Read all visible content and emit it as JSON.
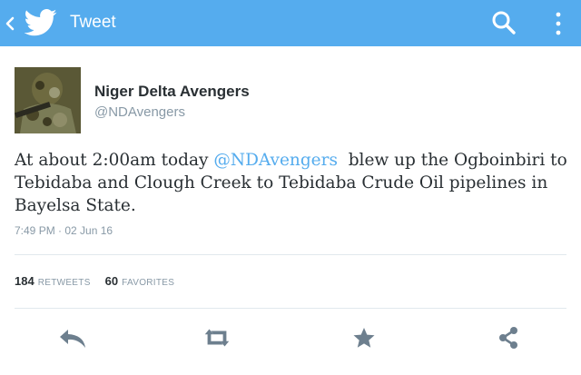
{
  "appbar": {
    "title": "Tweet",
    "color": "#55acee",
    "icons": [
      "back-chevron-icon",
      "twitter-bird-icon",
      "search-icon",
      "overflow-menu-icon"
    ]
  },
  "author": {
    "name": "Niger Delta Avengers",
    "handle": "@NDAvengers"
  },
  "tweet": {
    "text_before": "At about 2:00am today ",
    "mention": "@NDAvengers",
    "text_after": "  blew up the Ogboinbiri to Tebidaba and Clough Creek to Tebidaba Crude Oil pipelines in Bayelsa State.",
    "timestamp": "7:49 PM · 02 Jun 16"
  },
  "stats": {
    "retweets_count": "184",
    "retweets_label": "RETWEETS",
    "favorites_count": "60",
    "favorites_label": "FAVORITES"
  },
  "actions": [
    "reply-icon",
    "retweet-icon",
    "favorite-icon",
    "share-icon"
  ],
  "colors": {
    "accent": "#55acee",
    "text": "#292f33",
    "muted": "#8899a6",
    "icon": "#6d7f8e"
  }
}
